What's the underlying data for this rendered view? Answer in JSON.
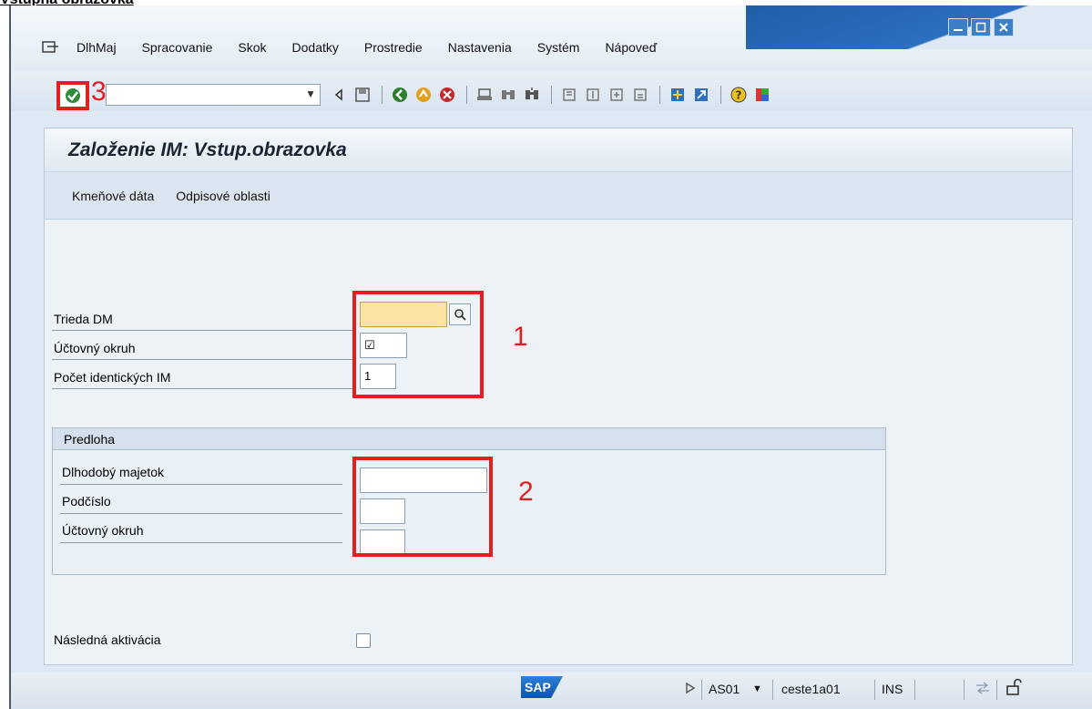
{
  "doc_heading": "Vstupná obrazovka",
  "menu": [
    "DlhMaj",
    "Spracovanie",
    "Skok",
    "Dodatky",
    "Prostredie",
    "Nastavenia",
    "Systém",
    "Nápoveď"
  ],
  "toolbar": {
    "command_value": "",
    "enter_annotation": "3"
  },
  "page_title": "Založenie IM: Vstup.obrazovka",
  "app_buttons": [
    "Kmeňové dáta",
    "Odpisové oblasti"
  ],
  "fields": {
    "trieda_dm": {
      "label": "Trieda DM",
      "value": ""
    },
    "uctovny_okruh": {
      "label": "Účtovný okruh",
      "value": "☑"
    },
    "pocet": {
      "label": "Počet identických IM",
      "value": "1"
    }
  },
  "annotations": {
    "box1": "1",
    "box2": "2"
  },
  "template_group": {
    "title": "Predloha",
    "rows": [
      {
        "label": "Dlhodobý majetok",
        "value": ""
      },
      {
        "label": "Podčíslo",
        "value": ""
      },
      {
        "label": "Účtovný okruh",
        "value": ""
      }
    ]
  },
  "followup": {
    "label": "Následná aktivácia",
    "checked": false
  },
  "status": {
    "logo": "SAP",
    "system": "AS01",
    "client_user": "ceste1a01",
    "mode": "INS"
  },
  "colors": {
    "accent_red": "#e02020",
    "window_blue": "#2c6fc0",
    "required_field": "#fbe3a0"
  }
}
